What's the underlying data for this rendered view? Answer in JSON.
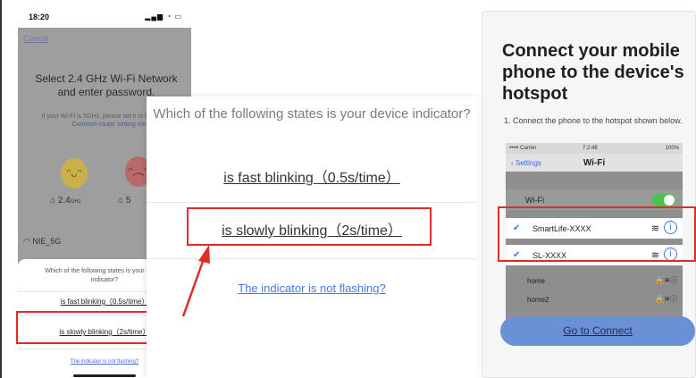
{
  "left_phone": {
    "status_time": "18:20",
    "cancel": "Cancel",
    "title": "Select 2.4 GHz Wi-Fi Network and enter password.",
    "subtitle": "If your Wi-Fi is 5GHz, please set it to be 2.4GHz.",
    "subtitle_link": "Common router setting me",
    "band_a": "2.4",
    "band_a_unit": "GHz",
    "band_b": "5",
    "wifi_name": "NIE_5G",
    "question": "Which of the following states is your device indicator?",
    "option_fast": "is fast blinking（0.5s/time）",
    "option_slow": "is slowly blinking（2s/time）",
    "not_flashing": "The indicator is not flashing?"
  },
  "zoom_panel": {
    "question": "Which of the following states is your device indicator?",
    "option_fast": "is fast blinking（0.5s/time）",
    "option_slow": "is slowly blinking（2s/time）",
    "not_flashing": "The indicator is not flashing?"
  },
  "right_panel": {
    "title": "Connect your mobile phone to the device's hotspot",
    "step": "1. Connect the phone to the hotspot shown below.",
    "shot": {
      "carrier": "••••• Carrier",
      "time": "7:2:48",
      "battery": "100%",
      "back": "Settings",
      "nav_title": "Wi-Fi",
      "wifi_label": "Wi-Fi",
      "networks": [
        "SmartLife-XXXX",
        "SL-XXXX"
      ],
      "others": [
        "home",
        "home2"
      ]
    },
    "button": "Go to Connect"
  },
  "colors": {
    "highlight": "#e02b2b",
    "link_blue": "#4a78e0",
    "button_blue": "#6a91d6",
    "toggle_green": "#4cc44c"
  }
}
